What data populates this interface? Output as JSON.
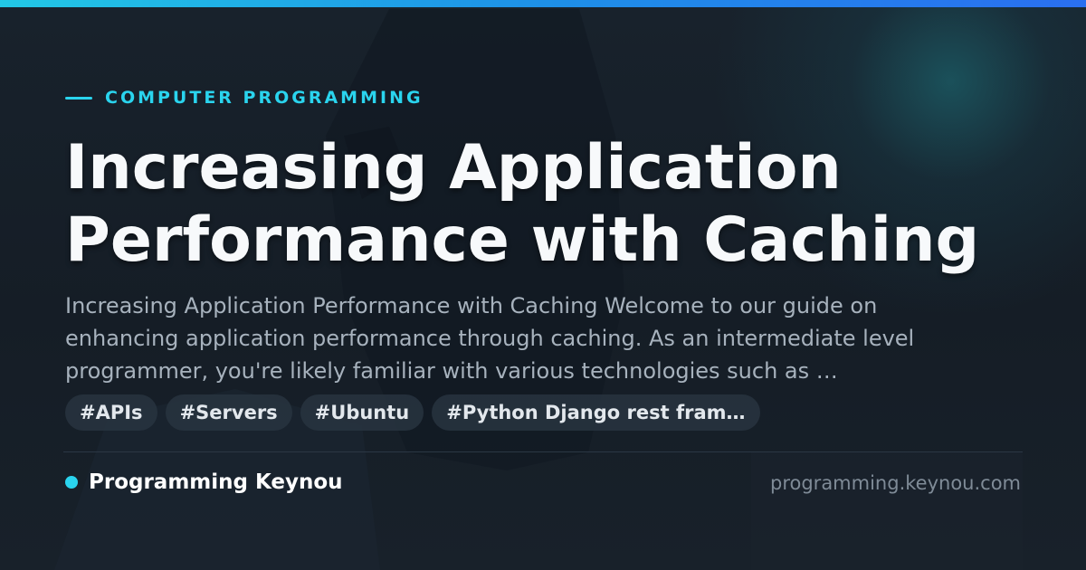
{
  "category": "COMPUTER PROGRAMMING",
  "title": "Increasing Application Performance with Caching",
  "description": "Increasing Application Performance with Caching Welcome to our guide on enhancing application performance through caching. As an intermediate level programmer, you're likely familiar with various technologies such as …",
  "tags": [
    "#APIs",
    "#Servers",
    "#Ubuntu",
    "#Python Django rest fram…"
  ],
  "brand": "Programming Keynou",
  "url": "programming.keynou.com",
  "colors": {
    "accent": "#2ad4ee",
    "background": "#151c25",
    "title": "#f7f9fb",
    "description": "#a7b2bd",
    "url": "#7f8b97"
  }
}
